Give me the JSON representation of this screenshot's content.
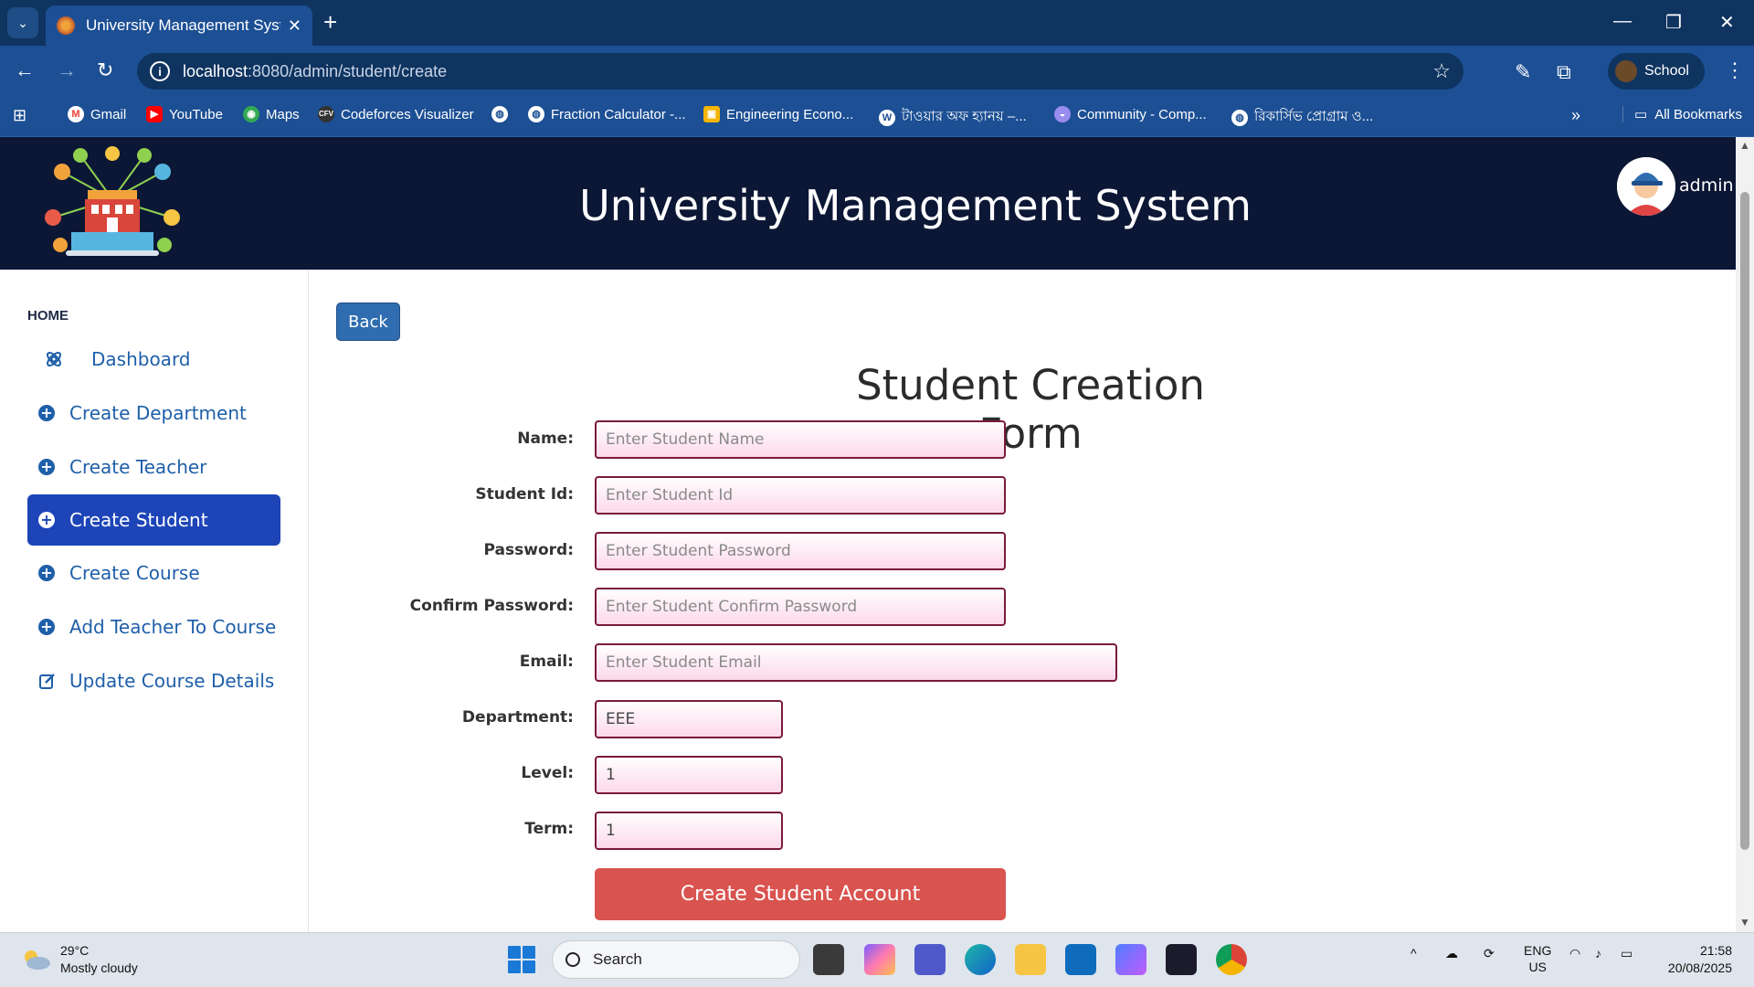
{
  "browser": {
    "tab_title": "University Management System",
    "url_host": "localhost",
    "url_path": ":8080/admin/student/create",
    "profile_name": "School",
    "bookmarks": [
      {
        "label": "Gmail",
        "icon": "gmail-icon",
        "color": "#ea4335"
      },
      {
        "label": "YouTube",
        "icon": "youtube-icon",
        "color": "#ff0000"
      },
      {
        "label": "Maps",
        "icon": "maps-icon",
        "color": "#34a853"
      },
      {
        "label": "Codeforces Visualizer",
        "icon": "codeforces-icon",
        "color": "#333333"
      },
      {
        "label": "",
        "icon": "globe-icon",
        "color": "#ffffff"
      },
      {
        "label": "Fraction Calculator -...",
        "icon": "globe-icon",
        "color": "#ffffff"
      },
      {
        "label": "Engineering Econo...",
        "icon": "slides-icon",
        "color": "#f4b400"
      },
      {
        "label": "টাওয়ার অফ হ্যানয় –...",
        "icon": "wordpress-icon",
        "color": "#ffffff"
      },
      {
        "label": "Community - Comp...",
        "icon": "community-icon",
        "color": "#9b8cf0"
      },
      {
        "label": "রিকার্সিভ প্রোগ্রাম ও...",
        "icon": "globe-icon",
        "color": "#ffffff"
      }
    ],
    "all_bookmarks": "All Bookmarks"
  },
  "app": {
    "title": "University Management System",
    "user": "admin"
  },
  "sidebar": {
    "heading": "HOME",
    "items": [
      {
        "label": "Dashboard",
        "icon": "dashboard-icon",
        "active": false
      },
      {
        "label": "Create Department",
        "icon": "plus-circle-icon",
        "active": false
      },
      {
        "label": "Create Teacher",
        "icon": "plus-circle-icon",
        "active": false
      },
      {
        "label": "Create Student",
        "icon": "plus-circle-icon",
        "active": true
      },
      {
        "label": "Create Course",
        "icon": "plus-circle-icon",
        "active": false
      },
      {
        "label": "Add Teacher To Course",
        "icon": "plus-circle-icon",
        "active": false
      },
      {
        "label": "Update Course Details",
        "icon": "edit-icon",
        "active": false
      }
    ]
  },
  "form": {
    "back_label": "Back",
    "title": "Student Creation Form",
    "fields": {
      "name": {
        "label": "Name:",
        "placeholder": "Enter Student Name",
        "value": ""
      },
      "student_id": {
        "label": "Student Id:",
        "placeholder": "Enter Student Id",
        "value": ""
      },
      "password": {
        "label": "Password:",
        "placeholder": "Enter Student Password",
        "value": ""
      },
      "confirm_password": {
        "label": "Confirm Password:",
        "placeholder": "Enter Student Confirm Password",
        "value": ""
      },
      "email": {
        "label": "Email:",
        "placeholder": "Enter Student Email",
        "value": ""
      },
      "department": {
        "label": "Department:",
        "placeholder": "",
        "value": "EEE"
      },
      "level": {
        "label": "Level:",
        "placeholder": "",
        "value": "1"
      },
      "term": {
        "label": "Term:",
        "placeholder": "",
        "value": "1"
      }
    },
    "submit_label": "Create Student Account"
  },
  "taskbar": {
    "temperature": "29°C",
    "weather": "Mostly cloudy",
    "search_placeholder": "Search",
    "lang_line1": "ENG",
    "lang_line2": "US",
    "time": "21:58",
    "date": "20/08/2025"
  },
  "colors": {
    "header_bg": "#0c1735",
    "active_item": "#1d45b8",
    "submit": "#d9534f",
    "back": "#2f6db0"
  }
}
